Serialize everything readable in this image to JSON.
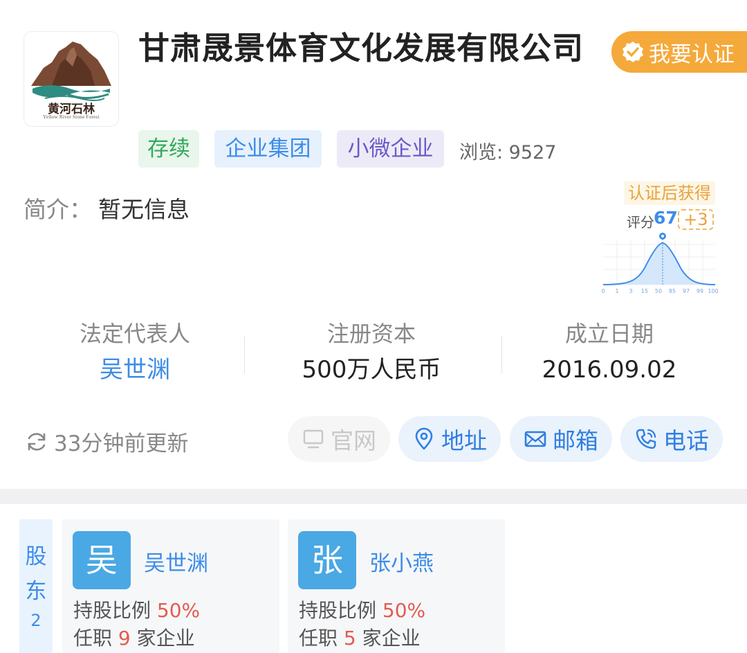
{
  "company": {
    "name": "甘肃晟景体育文化发展有限公司",
    "logo_text_cn": "黄河石林",
    "logo_text_en": "Yellow River Stone Forest"
  },
  "certify_button": {
    "label": "我要认证",
    "icon": "verified-badge-icon"
  },
  "tags": [
    {
      "label": "存续",
      "color": "#33a85a"
    },
    {
      "label": "企业集团",
      "color": "#3d8ce8"
    },
    {
      "label": "小微企业",
      "color": "#6b5ac8"
    }
  ],
  "views": "浏览: 9527",
  "intro": {
    "label": "简介：",
    "value": "暂无信息"
  },
  "score": {
    "tip": "认证后获得",
    "label": "评分",
    "value": "67",
    "bonus": "+3",
    "axis_ticks": [
      "0",
      "1",
      "3",
      "15",
      "50",
      "85",
      "97",
      "99",
      "100"
    ]
  },
  "info": [
    {
      "label": "法定代表人",
      "value": "吴世渊"
    },
    {
      "label": "注册资本",
      "value": "500万人民币"
    },
    {
      "label": "成立日期",
      "value": "2016.09.02"
    }
  ],
  "update": {
    "text": "33分钟前更新",
    "icon": "refresh-icon"
  },
  "actions": [
    {
      "label": "官网",
      "icon": "monitor-icon",
      "enabled": false
    },
    {
      "label": "地址",
      "icon": "location-pin-icon",
      "enabled": true
    },
    {
      "label": "邮箱",
      "icon": "mail-icon",
      "enabled": true
    },
    {
      "label": "电话",
      "icon": "phone-icon",
      "enabled": true
    }
  ],
  "shareholders": {
    "title_1": "股",
    "title_2": "东",
    "count": "2",
    "items": [
      {
        "avatar": "吴",
        "name": "吴世渊",
        "ratio_label": "持股比例",
        "ratio": "50%",
        "jobs_prefix": "任职",
        "jobs": "9",
        "jobs_suffix": "家企业"
      },
      {
        "avatar": "张",
        "name": "张小燕",
        "ratio_label": "持股比例",
        "ratio": "50%",
        "jobs_prefix": "任职",
        "jobs": "5",
        "jobs_suffix": "家企业"
      }
    ]
  },
  "colors": {
    "accent": "#3d8ce8",
    "certify": "#f5a93a",
    "warn": "#e35b4f"
  }
}
